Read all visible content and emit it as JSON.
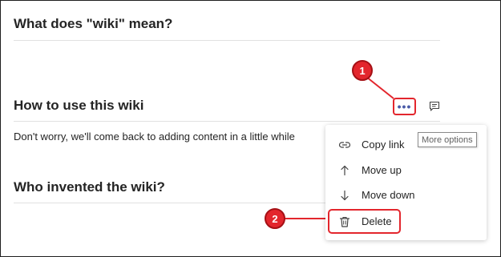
{
  "sections": [
    {
      "title": "What does \"wiki\" mean?"
    },
    {
      "title": "How to use this wiki",
      "body": "Don't worry, we'll come back to adding content in a little while"
    },
    {
      "title": "Who invented the wiki?"
    }
  ],
  "toolbar": {
    "more_label": "•••",
    "more_icon": "more-options-icon",
    "comment_icon": "comment-icon"
  },
  "tooltip": {
    "text": "More options"
  },
  "context_menu": {
    "items": [
      {
        "label": "Copy link",
        "icon": "link-icon"
      },
      {
        "label": "Move up",
        "icon": "arrow-up-icon"
      },
      {
        "label": "Move down",
        "icon": "arrow-down-icon"
      },
      {
        "label": "Delete",
        "icon": "trash-icon"
      }
    ]
  },
  "annotations": {
    "step1": "1",
    "step2": "2",
    "color": "#e3262d"
  }
}
